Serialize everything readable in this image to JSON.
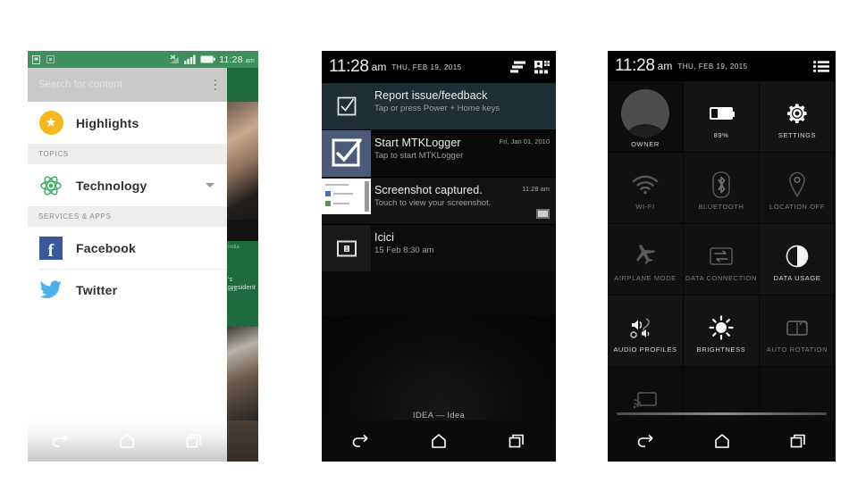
{
  "panels": {
    "news": {
      "status_bar": {
        "time": "11:28",
        "ampm": "am",
        "icons": [
          "sim-icon",
          "app-icon",
          "no-sim-x-icon",
          "signal-bars-icon",
          "battery-icon"
        ]
      },
      "search": {
        "placeholder": "Search for content",
        "menu": "overflow-menu"
      },
      "rows": [
        {
          "label": "Highlights",
          "icon": "star-icon"
        }
      ],
      "sections": [
        {
          "header": "TOPICS",
          "items": [
            {
              "label": "Technology",
              "icon": "atom-icon",
              "caret": "chevron-down-icon"
            }
          ]
        },
        {
          "header": "SERVICES & APPS",
          "items": [
            {
              "label": "Facebook",
              "icon": "facebook-icon"
            },
            {
              "label": "Twitter",
              "icon": "twitter-icon"
            }
          ]
        }
      ],
      "background_article": {
        "headline_fragment": "'s president",
        "sub_fragment": "india"
      },
      "nav": {
        "back": "back-icon",
        "home": "home-icon",
        "recents": "recents-icon"
      }
    },
    "notifications": {
      "status_bar": {
        "time": "11:28",
        "ampm": "am",
        "date": "THU, FEB 19, 2015",
        "clear_all": "clear-all-icon",
        "quick_settings": "quick-settings-icon"
      },
      "items": [
        {
          "icon": "checkbox-icon",
          "title": "Report issue/feedback",
          "subtitle": "Tap or press Power + Home keys",
          "time": ""
        },
        {
          "icon": "checkbox-checked-icon",
          "title": "Start MTKLogger",
          "subtitle": "Tap to start MTKLogger",
          "time": "Fri, Jan 01, 2010"
        },
        {
          "icon": "screenshot-thumbnail",
          "title": "Screenshot captured.",
          "subtitle": "Touch to view your screenshot.",
          "time": "11:28 am"
        },
        {
          "icon": "calendar-icon",
          "title": "Icici",
          "subtitle": "15 Feb 8:30 am",
          "time": ""
        }
      ],
      "carrier": "IDEA — Idea",
      "nav": {
        "back": "back-icon",
        "home": "home-icon",
        "recents": "recents-icon"
      }
    },
    "quick_settings": {
      "status_bar": {
        "time": "11:28",
        "ampm": "am",
        "date": "THU, FEB 19, 2015",
        "list_toggle": "notification-list-icon"
      },
      "tiles": [
        {
          "label": "OWNER",
          "icon": "user-avatar-icon",
          "state": "on"
        },
        {
          "label": "89%",
          "icon": "battery-icon",
          "state": "on"
        },
        {
          "label": "SETTINGS",
          "icon": "gear-icon",
          "state": "on"
        },
        {
          "label": "WI-FI",
          "icon": "wifi-icon",
          "state": "off"
        },
        {
          "label": "BLUETOOTH",
          "icon": "bluetooth-icon",
          "state": "off"
        },
        {
          "label": "LOCATION OFF",
          "icon": "location-pin-icon",
          "state": "off"
        },
        {
          "label": "AIRPLANE MODE",
          "icon": "airplane-icon",
          "state": "off"
        },
        {
          "label": "DATA CONNECTION",
          "icon": "data-transfer-icon",
          "state": "off"
        },
        {
          "label": "DATA USAGE",
          "icon": "pie-chart-icon",
          "state": "on"
        },
        {
          "label": "AUDIO PROFILES",
          "icon": "speaker-icon",
          "state": "on"
        },
        {
          "label": "BRIGHTNESS",
          "icon": "brightness-sun-icon",
          "state": "on"
        },
        {
          "label": "AUTO ROTATION",
          "icon": "rotation-lock-icon",
          "state": "off"
        },
        {
          "label": "",
          "icon": "cast-screen-icon",
          "state": "off"
        }
      ],
      "nav": {
        "back": "back-icon",
        "home": "home-icon",
        "recents": "recents-icon"
      }
    }
  },
  "colors": {
    "news_accent": "#3e8f5d",
    "star": "#f5b820",
    "facebook": "#3b5998",
    "twitter": "#4db2ec",
    "technology": "#3fae68",
    "dark_bg": "#0a0a0a"
  }
}
